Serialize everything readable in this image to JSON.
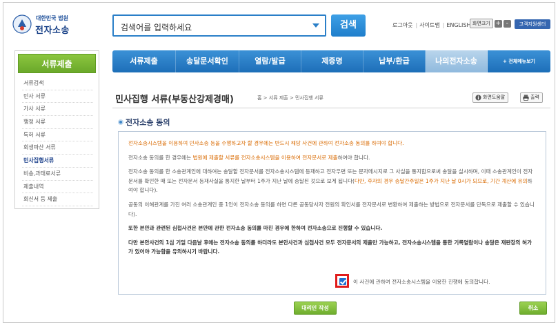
{
  "header": {
    "logo_court": "대한민국 법원",
    "logo_name": "전자소송",
    "search_placeholder": "검색어를 입력하세요",
    "search_button": "검색",
    "util_links": [
      "로그아웃",
      "사이트맵",
      "ENGLISH"
    ],
    "zoom_label": "화면크기",
    "zoom_plus": "+",
    "zoom_minus": "-",
    "customer_center": "고객지원센터"
  },
  "sidebar": {
    "title": "서류제출",
    "items": [
      {
        "label": "서류검색"
      },
      {
        "label": "민사 서류"
      },
      {
        "label": "가사 서류"
      },
      {
        "label": "행정 서류"
      },
      {
        "label": "특허 서류"
      },
      {
        "label": "회생파산 서류"
      },
      {
        "label": "민사집행서류"
      },
      {
        "label": "비송,과태료서류"
      },
      {
        "label": "제출내역"
      },
      {
        "label": "회신서 등 제출"
      }
    ],
    "active_index": 6
  },
  "topnav": {
    "tabs": [
      {
        "label": "서류제출"
      },
      {
        "label": "송달문서확인"
      },
      {
        "label": "열람/발급"
      },
      {
        "label": "제증명"
      },
      {
        "label": "납부/환급"
      },
      {
        "label": "나의전자소송"
      }
    ],
    "active_index": 5,
    "all_menu": "+ 전체메뉴보기"
  },
  "page": {
    "title": "민사집행 서류(부동산강제경매)",
    "breadcrumb": "홈 > 서류 제출 > 민사집행 서류",
    "help_button": "화면도움말",
    "print_button": "출력",
    "section_title": "전자소송 동의"
  },
  "content": {
    "p1": "전자소송시스템을 이용하여 민사소송 등을 수행하고자 할 경우에는 반드시 해당 사건에 관하여 전자소송 동의를 하여야 합니다.",
    "p2_a": "전자소송 동의를 한 경우에는 ",
    "p2_b": "법원에 제출할 서류를 전자소송시스템을 이용하여 전자문서로 제출",
    "p2_c": "하여야 합니다.",
    "p3_a": "전자소송 동의를 한 소송관계인에 대하여는 송달할 전자문서를 전자소송시스템에 등재하고 전자우편 또는 문자메시지로 그 사실을 통지함으로써 송달을 실시하며, 이때 소송관계인이 전자문서를 확인한 때 또는 전자문서 등재사실을 통지한 날부터 1주가 지난 날에 송달된 것으로 보게 됩니다(",
    "p3_b": "다만, 후자의 경우 송달간주일은 1주가 지난 날 0시가 되므로, 기간 계산에 유의",
    "p3_c": "하여야 합니다).",
    "p4": "공동의 이해관계를 가진 여러 소송관계인 중 1인이 전자소송 동의를 하면 다른 공동당사자 전원의 확인서를 전자문서로 변환하여 제출하는 방법으로 전자문서를 단독으로 제출할 수 있습니다).",
    "p5": "또한 본안과 관련된 심첩사건은 본안에 관한 전자소송 동의를 마친 경우에 한하여 전자소송으로 진행할 수 있습니다.",
    "p6": "다만 본안사건의 1심 기일 다음날 후에는 전자소송 동의를 하더라도 본안사건과 심첩사건 모두 전자문서의 제출만 가능하고, 전자소송시스템을 통한 기록열람이나 송달은 재판장의 허가가 있어야 가능함을 유의하시기 바랍니다.",
    "agree_label": "이 사건에 관하여 전자소송시스템을 이용한 진행에 동의합니다.",
    "agree_checked": true
  },
  "buttons": {
    "proxy": "대리인 작성",
    "cancel": "취소"
  }
}
